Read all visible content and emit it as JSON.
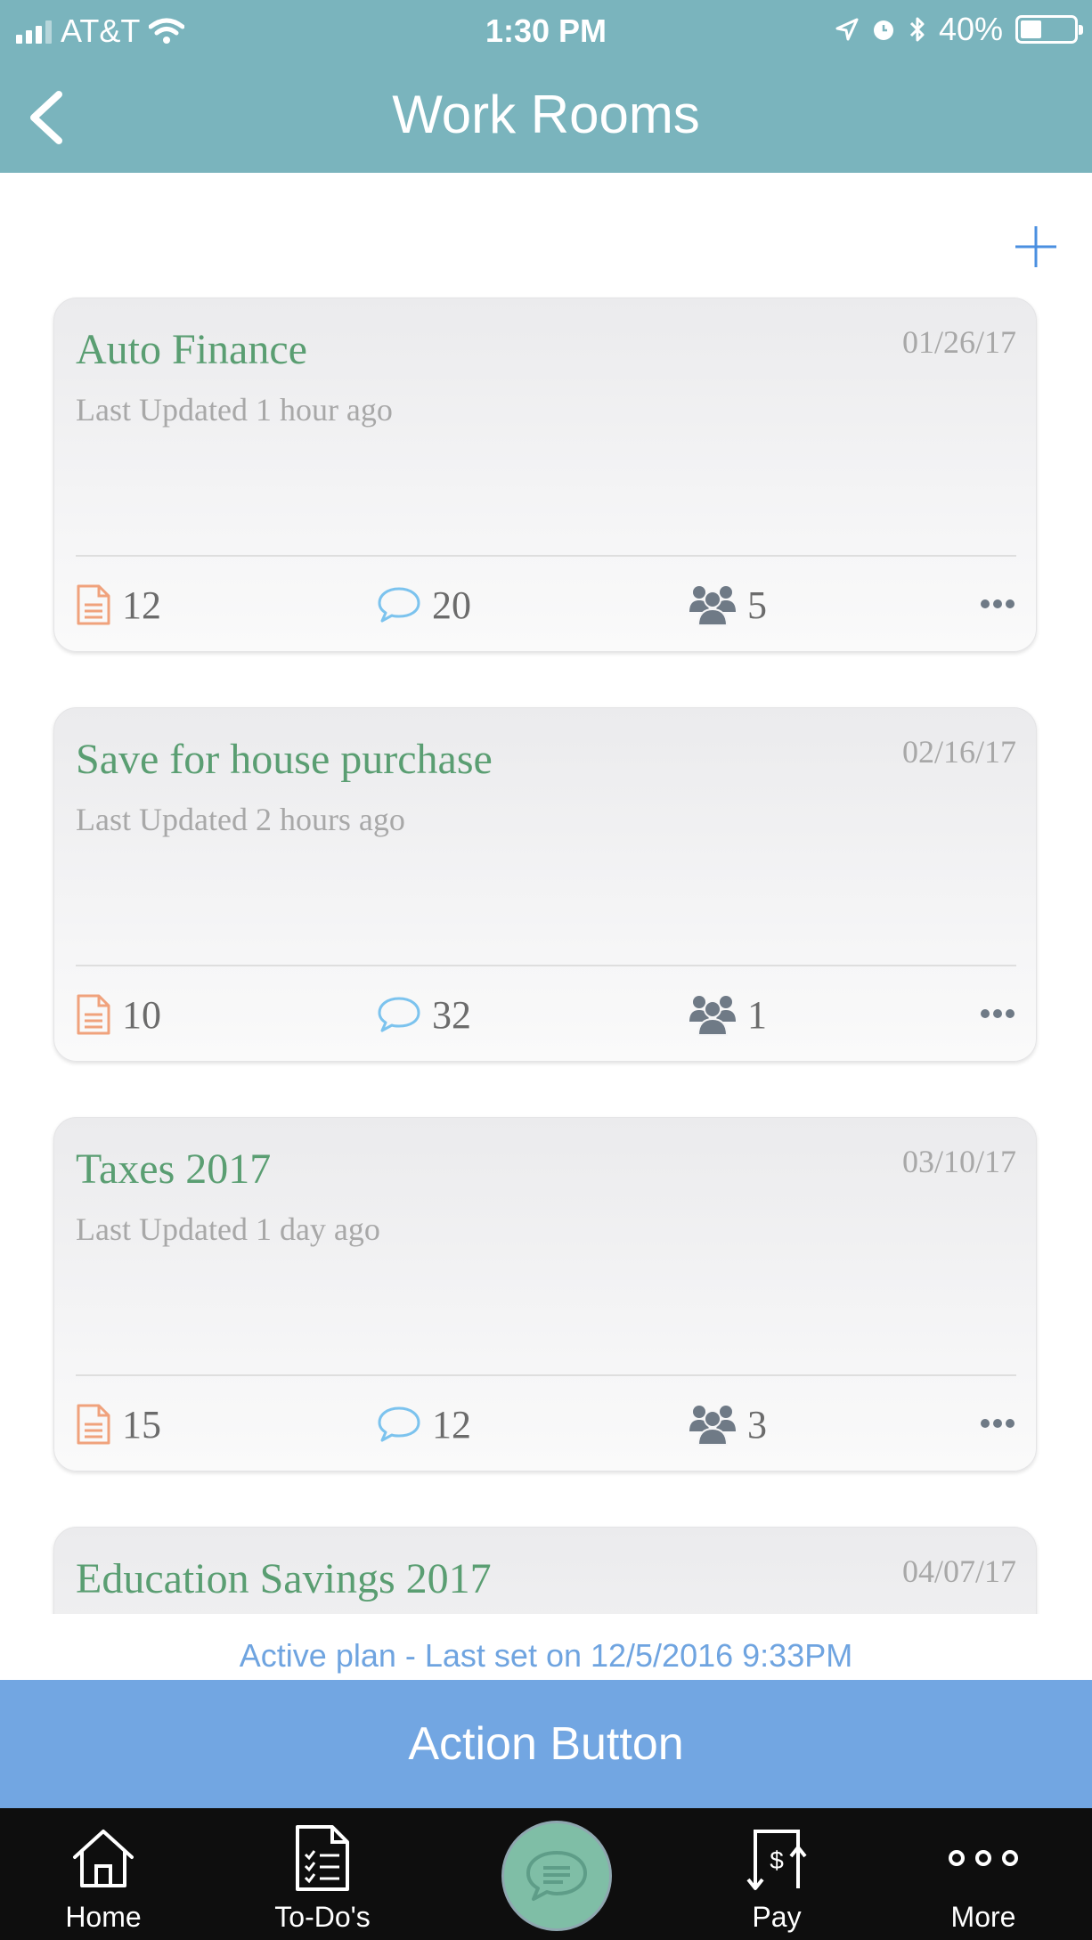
{
  "status_bar": {
    "carrier": "AT&T",
    "time": "1:30 PM",
    "battery": "40%",
    "battery_level": 0.4
  },
  "header": {
    "title": "Work Rooms",
    "background_color": "#7ab4bd"
  },
  "rooms": [
    {
      "title": "Auto Finance",
      "date": "01/26/17",
      "updated": "Last Updated 1 hour ago",
      "docs": "12",
      "comments": "20",
      "members": "5"
    },
    {
      "title": "Save for house purchase",
      "date": "02/16/17",
      "updated": "Last Updated 2 hours ago",
      "docs": "10",
      "comments": "32",
      "members": "1"
    },
    {
      "title": "Taxes 2017",
      "date": "03/10/17",
      "updated": "Last Updated 1 day ago",
      "docs": "15",
      "comments": "12",
      "members": "3"
    },
    {
      "title": "Education Savings 2017",
      "date": "04/07/17"
    }
  ],
  "active_plan": "Active plan - Last set on 12/5/2016 9:33PM",
  "action_button": "Action Button",
  "tabs": {
    "home": "Home",
    "todos": "To-Do's",
    "pay": "Pay",
    "more": "More"
  },
  "icons": {
    "back": "chevron-left-icon",
    "add": "plus-icon",
    "docs": "document-icon",
    "comments": "speech-bubble-icon",
    "members": "group-icon",
    "more": "ellipsis-icon",
    "chat": "chat-icon"
  },
  "colors": {
    "title_green": "#5a9e72",
    "accent_blue": "#72a6e2",
    "doc_orange": "#f0a27c",
    "comment_blue": "#7cc3ee",
    "member_gray": "#6f7a86"
  }
}
